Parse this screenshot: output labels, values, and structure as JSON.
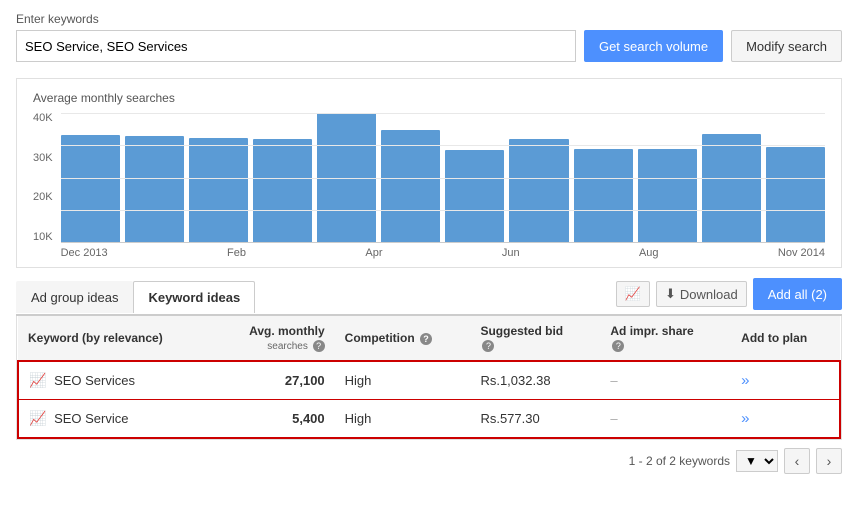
{
  "header": {
    "label": "Enter keywords",
    "input_value": "SEO Service, SEO Services",
    "input_placeholder": "SEO Service, SEO Services",
    "btn_get_search_volume": "Get search volume",
    "btn_modify_search": "Modify search"
  },
  "chart": {
    "title": "Average monthly searches",
    "y_labels": [
      "40K",
      "30K",
      "20K",
      "10K"
    ],
    "bars": [
      {
        "month": "Dec 2013",
        "height_pct": 83
      },
      {
        "month": "",
        "height_pct": 82
      },
      {
        "month": "Feb",
        "height_pct": 81
      },
      {
        "month": "",
        "height_pct": 80
      },
      {
        "month": "Apr",
        "height_pct": 100
      },
      {
        "month": "",
        "height_pct": 87
      },
      {
        "month": "Jun",
        "height_pct": 71
      },
      {
        "month": "",
        "height_pct": 80
      },
      {
        "month": "Aug",
        "height_pct": 72
      },
      {
        "month": "",
        "height_pct": 72
      },
      {
        "month": "",
        "height_pct": 84
      },
      {
        "month": "Nov 2014",
        "height_pct": 74
      }
    ],
    "x_labels": [
      "Dec 2013",
      "Feb",
      "Apr",
      "Jun",
      "Aug",
      "Nov 2014"
    ]
  },
  "tabs": [
    {
      "label": "Ad group ideas",
      "active": false
    },
    {
      "label": "Keyword ideas",
      "active": true
    }
  ],
  "actions": {
    "chart_icon": "📈",
    "download": "Download",
    "add_all": "Add all (2)"
  },
  "table": {
    "columns": [
      {
        "label": "Keyword (by relevance)",
        "sub": ""
      },
      {
        "label": "Avg. monthly",
        "sub": "searches"
      },
      {
        "label": "Competition",
        "sub": ""
      },
      {
        "label": "Suggested bid",
        "sub": ""
      },
      {
        "label": "Ad impr. share",
        "sub": ""
      },
      {
        "label": "Add to plan",
        "sub": ""
      }
    ],
    "rows": [
      {
        "keyword": "SEO Services",
        "trend": "📈",
        "avg_monthly": "27,100",
        "competition": "High",
        "suggested_bid": "Rs.1,032.38",
        "ad_impr_share": "–",
        "add_to_plan": "»",
        "highlighted": true
      },
      {
        "keyword": "SEO Service",
        "trend": "📈",
        "avg_monthly": "5,400",
        "competition": "High",
        "suggested_bid": "Rs.577.30",
        "ad_impr_share": "–",
        "add_to_plan": "»",
        "highlighted": true
      }
    ]
  },
  "pagination": {
    "summary": "1 - 2 of 2 keywords"
  }
}
